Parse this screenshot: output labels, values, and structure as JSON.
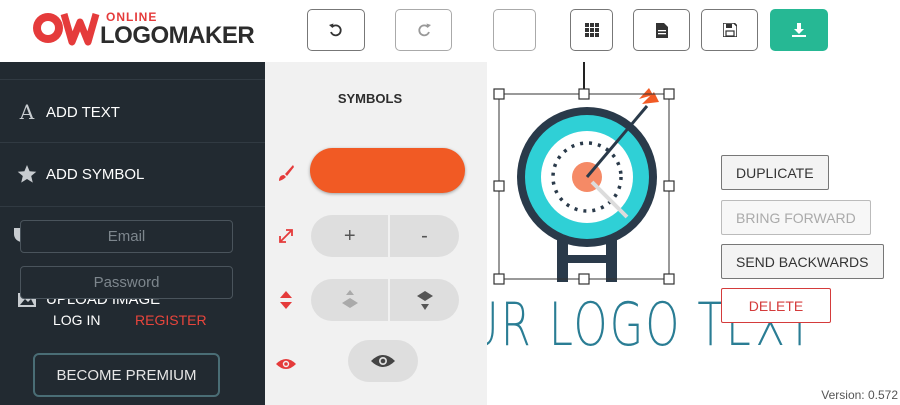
{
  "brand": {
    "online": "ONLINE",
    "name": "LOGOMAKER"
  },
  "toolbar": {
    "undo": "undo",
    "redo": "redo",
    "grid": "grid",
    "page": "page",
    "save": "save",
    "download": "download"
  },
  "sidebar": {
    "add_text": "ADD TEXT",
    "add_symbol": "ADD SYMBOL",
    "upload_image": "UPLOAD IMAGE",
    "email_placeholder": "Email",
    "password_placeholder": "Password",
    "login": "LOG IN",
    "register": "REGISTER",
    "premium": "BECOME PREMIUM"
  },
  "tools": {
    "title": "SYMBOLS",
    "color": "#f15a24",
    "size_plus": "+",
    "size_minus": "-"
  },
  "canvas": {
    "logo_text": "UR LOGO TEXT",
    "actions": {
      "duplicate": "DUPLICATE",
      "bring_forward": "BRING FORWARD",
      "send_backwards": "SEND BACKWARDS",
      "delete": "DELETE"
    },
    "version": "Version: 0.572"
  },
  "colors": {
    "sidebar_bg": "#222a31",
    "accent_red": "#e53b3b",
    "download_green": "#26b894",
    "symbol_orange": "#f15a24",
    "target_cyan": "#2fd0d6",
    "target_dark": "#2a3a4a",
    "text_blue": "#2a7d94"
  }
}
